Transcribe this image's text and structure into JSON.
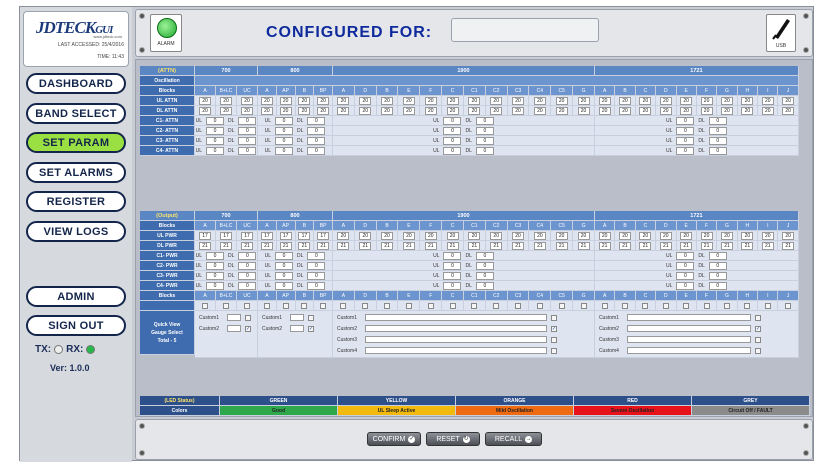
{
  "logo": {
    "text": "JDTECK",
    "text2": "GUI",
    "url": "www.jdteck.com"
  },
  "last_accessed": "LAST ACCESSED: 25/4/2016",
  "time": "TIME: 11:43",
  "nav": [
    "DASHBOARD",
    "BAND SELECT",
    "SET PARAM",
    "SET ALARMS",
    "REGISTER",
    "VIEW LOGS",
    "ADMIN",
    "SIGN OUT"
  ],
  "tx_label": "TX:",
  "rx_label": "RX:",
  "version": "Ver: 1.0.0",
  "alarm_label": "ALARM",
  "configured_for": "CONFIGURED FOR:",
  "usb_label": "USB",
  "bands": [
    "700",
    "800",
    "1900",
    "1721"
  ],
  "attn_title": "(ATTN)",
  "output_title": "(Output)",
  "row_labels_attn": [
    "Oscillation",
    "Blocks",
    "UL ATTN",
    "DL ATTN",
    "C1- ATTN",
    "C2- ATTN",
    "C3- ATTN",
    "C4- ATTN"
  ],
  "row_labels_out": [
    "Blocks",
    "UL PWR",
    "DL PWR",
    "C1- PWR",
    "C2- PWR",
    "C3- PWR",
    "C4- PWR",
    "Blocks"
  ],
  "blocks_700": [
    "A",
    "B+LC",
    "UC"
  ],
  "blocks_800": [
    "A",
    "AP",
    "B",
    "BP"
  ],
  "blocks_1900": [
    "A",
    "D",
    "B",
    "E",
    "F",
    "C",
    "C1",
    "C2",
    "C3",
    "C4",
    "C5",
    "G"
  ],
  "blocks_1721": [
    "A",
    "B",
    "C",
    "D",
    "E",
    "F",
    "G",
    "H",
    "I",
    "J"
  ],
  "attn_value": "20",
  "pwr_value": "17",
  "pwr_dl_value": "21",
  "pwr_1900_value": "20",
  "ul_label": "UL",
  "dl_label": "DL",
  "zero": "0",
  "quick_view": [
    "Quick View",
    "Gauge Select",
    "Total - 5"
  ],
  "custom": [
    "Custom1",
    "Custom2",
    "Custom3",
    "Custom4"
  ],
  "led_status": {
    "label": "(LED Status)",
    "colors_label": "Colors",
    "items": [
      {
        "name": "GREEN",
        "desc": "Good",
        "color": "#2ea84a"
      },
      {
        "name": "YELLOW",
        "desc": "UL Sleep Active",
        "color": "#f2b90f"
      },
      {
        "name": "ORANGE",
        "desc": "Mild Oscillation",
        "color": "#f06a12"
      },
      {
        "name": "RED",
        "desc": "Severe Oscillation",
        "color": "#e8121a"
      },
      {
        "name": "GREY",
        "desc": "Circuit Off / FAULT",
        "color": "#8b8b8b"
      }
    ]
  },
  "buttons": {
    "confirm": "CONFIRM",
    "reset": "RESET",
    "recall": "RECALL"
  }
}
